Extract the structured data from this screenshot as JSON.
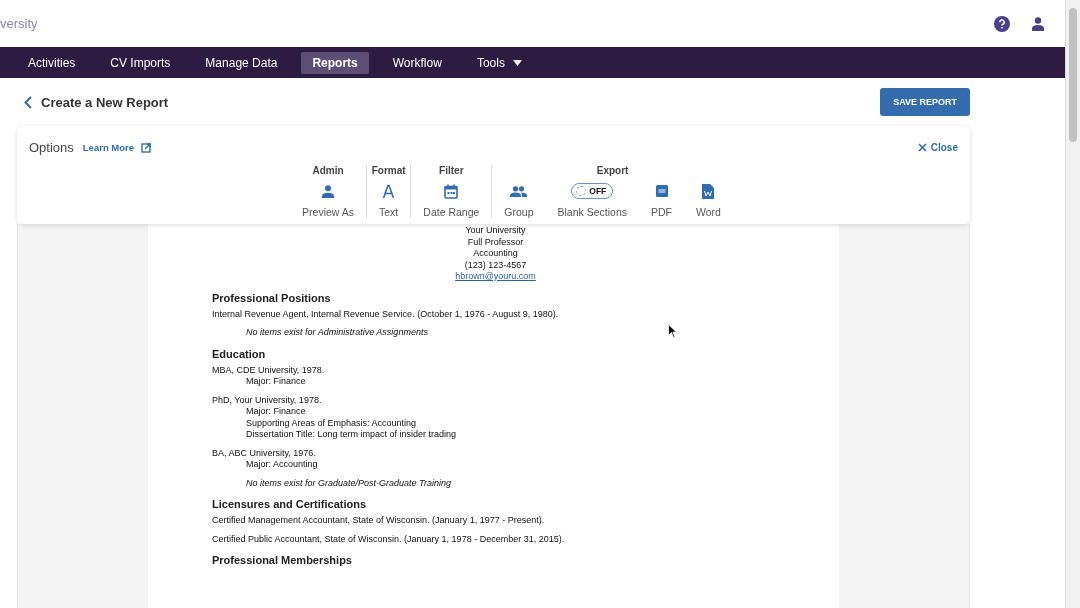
{
  "brand": "versity",
  "nav": [
    {
      "label": "Activities",
      "selected": false
    },
    {
      "label": "CV Imports",
      "selected": false
    },
    {
      "label": "Manage Data",
      "selected": false
    },
    {
      "label": "Reports",
      "selected": true
    },
    {
      "label": "Workflow",
      "selected": false
    },
    {
      "label": "Tools",
      "selected": false,
      "dropdown": true
    }
  ],
  "page_title": "Create a New Report",
  "save_button": "SAVE REPORT",
  "options": {
    "title": "Options",
    "learn_more": "Learn More",
    "close": "Close",
    "groups": [
      {
        "label": "Admin",
        "tools": [
          {
            "kind": "person",
            "label": "Preview As"
          }
        ]
      },
      {
        "label": "Format",
        "tools": [
          {
            "kind": "letter",
            "label": "Text"
          }
        ]
      },
      {
        "label": "Filter",
        "tools": [
          {
            "kind": "calendar",
            "label": "Date Range"
          }
        ]
      },
      {
        "label": "Export",
        "tools": [
          {
            "kind": "group",
            "label": "Group"
          },
          {
            "kind": "toggle",
            "label": "Blank Sections",
            "toggle_text": "OFF",
            "on": false
          },
          {
            "kind": "pdf",
            "label": "PDF"
          },
          {
            "kind": "word",
            "label": "Word"
          }
        ]
      }
    ]
  },
  "document": {
    "header_lines": [
      "Your University",
      "Full Professor",
      "Accounting",
      "(123) 123-4567"
    ],
    "email": "hbrown@youru.com",
    "sections": [
      {
        "heading": "Professional Positions",
        "entries": [
          {
            "kind": "entry",
            "text": "Internal Revenue Agent, Internal Revenue Service. (October 1, 1976 - August 9, 1980)."
          },
          {
            "kind": "note",
            "text": "No items exist for Administrative Assignments"
          }
        ]
      },
      {
        "heading": "Education",
        "entries": [
          {
            "kind": "entry",
            "text": "MBA, CDE University, 1978.",
            "details": [
              "Major: Finance"
            ]
          },
          {
            "kind": "entry",
            "text": "PhD, Your University, 1978.",
            "details": [
              "Major: Finance",
              "Supporting Areas of Emphasis: Accounting",
              "Dissertation Title: Long term impact of insider trading"
            ]
          },
          {
            "kind": "entry",
            "text": "BA, ABC University, 1976.",
            "details": [
              "Major: Accounting"
            ]
          },
          {
            "kind": "note",
            "text": "No items exist for Graduate/Post-Graduate Training"
          }
        ]
      },
      {
        "heading": "Licensures and Certifications",
        "entries": [
          {
            "kind": "entry",
            "text": "Certified Management Accountant, State of Wisconsin. (January 1, 1977 - Present)."
          },
          {
            "kind": "entry",
            "text": "Certified Public Accountant, State of Wisconsin. (January 1, 1978 - December 31, 2015)."
          }
        ]
      },
      {
        "heading": "Professional Memberships"
      }
    ]
  }
}
